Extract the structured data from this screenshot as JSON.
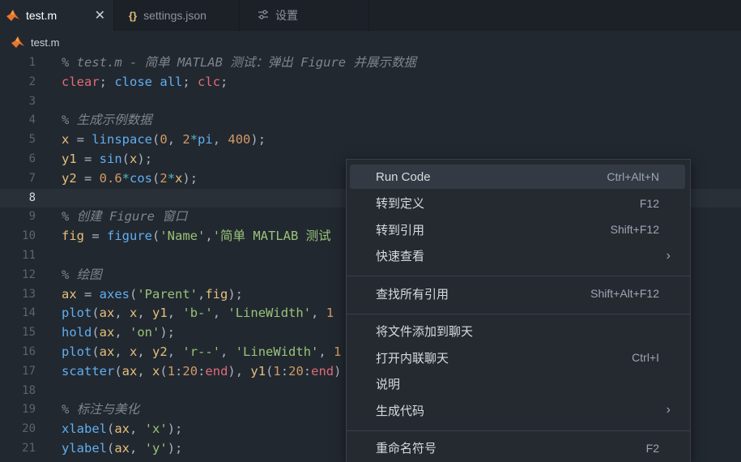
{
  "tabs": [
    {
      "label": "test.m",
      "icon": "matlab-icon",
      "close": "✕"
    },
    {
      "label": "settings.json",
      "icon": "json-braces-icon",
      "glyph": "{}"
    },
    {
      "label": "设置",
      "icon": "settings-sliders-icon",
      "glyph": "⚟"
    }
  ],
  "breadcrumb": {
    "file": "test.m"
  },
  "editor": {
    "current_line": 8,
    "lines": [
      {
        "n": "1",
        "tokens": [
          [
            "cm",
            "% test.m - 简单 MATLAB 测试：弹出 Figure 并展示数据"
          ]
        ]
      },
      {
        "n": "2",
        "tokens": [
          [
            "kw",
            "clear"
          ],
          [
            "pl",
            "; "
          ],
          [
            "fn",
            "close"
          ],
          [
            "pl",
            " "
          ],
          [
            "fn",
            "all"
          ],
          [
            "pl",
            "; "
          ],
          [
            "kw",
            "clc"
          ],
          [
            "pl",
            ";"
          ]
        ]
      },
      {
        "n": "3",
        "tokens": []
      },
      {
        "n": "4",
        "tokens": [
          [
            "cm",
            "% 生成示例数据"
          ]
        ]
      },
      {
        "n": "5",
        "tokens": [
          [
            "id",
            "x"
          ],
          [
            "pl",
            " = "
          ],
          [
            "fn",
            "linspace"
          ],
          [
            "pl",
            "("
          ],
          [
            "num",
            "0"
          ],
          [
            "pl",
            ", "
          ],
          [
            "num",
            "2"
          ],
          [
            "op",
            "*"
          ],
          [
            "fn",
            "pi"
          ],
          [
            "pl",
            ", "
          ],
          [
            "num",
            "400"
          ],
          [
            "pl",
            ");"
          ]
        ]
      },
      {
        "n": "6",
        "tokens": [
          [
            "id",
            "y1"
          ],
          [
            "pl",
            " = "
          ],
          [
            "fn",
            "sin"
          ],
          [
            "pl",
            "("
          ],
          [
            "id",
            "x"
          ],
          [
            "pl",
            ");"
          ]
        ]
      },
      {
        "n": "7",
        "tokens": [
          [
            "id",
            "y2"
          ],
          [
            "pl",
            " = "
          ],
          [
            "num",
            "0.6"
          ],
          [
            "op",
            "*"
          ],
          [
            "fn",
            "cos"
          ],
          [
            "pl",
            "("
          ],
          [
            "num",
            "2"
          ],
          [
            "op",
            "*"
          ],
          [
            "id",
            "x"
          ],
          [
            "pl",
            ");"
          ]
        ]
      },
      {
        "n": "8",
        "tokens": []
      },
      {
        "n": "9",
        "tokens": [
          [
            "cm",
            "% 创建 Figure 窗口"
          ]
        ]
      },
      {
        "n": "10",
        "tokens": [
          [
            "id",
            "fig"
          ],
          [
            "pl",
            " = "
          ],
          [
            "fn",
            "figure"
          ],
          [
            "pl",
            "("
          ],
          [
            "str",
            "'Name'"
          ],
          [
            "pl",
            ","
          ],
          [
            "str",
            "'简单 MATLAB 测试"
          ]
        ]
      },
      {
        "n": "11",
        "tokens": []
      },
      {
        "n": "12",
        "tokens": [
          [
            "cm",
            "% 绘图"
          ]
        ]
      },
      {
        "n": "13",
        "tokens": [
          [
            "id",
            "ax"
          ],
          [
            "pl",
            " = "
          ],
          [
            "fn",
            "axes"
          ],
          [
            "pl",
            "("
          ],
          [
            "str",
            "'Parent'"
          ],
          [
            "pl",
            ","
          ],
          [
            "id",
            "fig"
          ],
          [
            "pl",
            ");"
          ]
        ]
      },
      {
        "n": "14",
        "tokens": [
          [
            "fn",
            "plot"
          ],
          [
            "pl",
            "("
          ],
          [
            "id",
            "ax"
          ],
          [
            "pl",
            ", "
          ],
          [
            "id",
            "x"
          ],
          [
            "pl",
            ", "
          ],
          [
            "id",
            "y1"
          ],
          [
            "pl",
            ", "
          ],
          [
            "str",
            "'b-'"
          ],
          [
            "pl",
            ", "
          ],
          [
            "str",
            "'LineWidth'"
          ],
          [
            "pl",
            ", "
          ],
          [
            "num",
            "1"
          ]
        ]
      },
      {
        "n": "15",
        "tokens": [
          [
            "fn",
            "hold"
          ],
          [
            "pl",
            "("
          ],
          [
            "id",
            "ax"
          ],
          [
            "pl",
            ", "
          ],
          [
            "str",
            "'on'"
          ],
          [
            "pl",
            ");"
          ]
        ]
      },
      {
        "n": "16",
        "tokens": [
          [
            "fn",
            "plot"
          ],
          [
            "pl",
            "("
          ],
          [
            "id",
            "ax"
          ],
          [
            "pl",
            ", "
          ],
          [
            "id",
            "x"
          ],
          [
            "pl",
            ", "
          ],
          [
            "id",
            "y2"
          ],
          [
            "pl",
            ", "
          ],
          [
            "str",
            "'r--'"
          ],
          [
            "pl",
            ", "
          ],
          [
            "str",
            "'LineWidth'"
          ],
          [
            "pl",
            ", "
          ],
          [
            "num",
            "1"
          ]
        ]
      },
      {
        "n": "17",
        "tokens": [
          [
            "fn",
            "scatter"
          ],
          [
            "pl",
            "("
          ],
          [
            "id",
            "ax"
          ],
          [
            "pl",
            ", "
          ],
          [
            "id",
            "x"
          ],
          [
            "pl",
            "("
          ],
          [
            "num",
            "1"
          ],
          [
            "pl",
            ":"
          ],
          [
            "num",
            "20"
          ],
          [
            "pl",
            ":"
          ],
          [
            "kw",
            "end"
          ],
          [
            "pl",
            "), "
          ],
          [
            "id",
            "y1"
          ],
          [
            "pl",
            "("
          ],
          [
            "num",
            "1"
          ],
          [
            "pl",
            ":"
          ],
          [
            "num",
            "20"
          ],
          [
            "pl",
            ":"
          ],
          [
            "kw",
            "end"
          ],
          [
            "pl",
            ")"
          ]
        ]
      },
      {
        "n": "18",
        "tokens": []
      },
      {
        "n": "19",
        "tokens": [
          [
            "cm",
            "% 标注与美化"
          ]
        ]
      },
      {
        "n": "20",
        "tokens": [
          [
            "fn",
            "xlabel"
          ],
          [
            "pl",
            "("
          ],
          [
            "id",
            "ax"
          ],
          [
            "pl",
            ", "
          ],
          [
            "str",
            "'x'"
          ],
          [
            "pl",
            ");"
          ]
        ]
      },
      {
        "n": "21",
        "tokens": [
          [
            "fn",
            "ylabel"
          ],
          [
            "pl",
            "("
          ],
          [
            "id",
            "ax"
          ],
          [
            "pl",
            ", "
          ],
          [
            "str",
            "'y'"
          ],
          [
            "pl",
            ");"
          ]
        ]
      }
    ]
  },
  "context_menu": {
    "items": [
      {
        "label": "Run Code",
        "shortcut": "Ctrl+Alt+N",
        "highlight": true
      },
      {
        "label": "转到定义",
        "shortcut": "F12"
      },
      {
        "label": "转到引用",
        "shortcut": "Shift+F12"
      },
      {
        "label": "快速查看",
        "submenu": "›"
      },
      {
        "separator": true
      },
      {
        "label": "查找所有引用",
        "shortcut": "Shift+Alt+F12"
      },
      {
        "separator": true
      },
      {
        "label": "将文件添加到聊天",
        "shortcut": ""
      },
      {
        "label": "打开内联聊天",
        "shortcut": "Ctrl+I"
      },
      {
        "label": "说明",
        "shortcut": ""
      },
      {
        "label": "生成代码",
        "submenu": "›"
      },
      {
        "separator": true
      },
      {
        "label": "重命名符号",
        "shortcut": "F2"
      }
    ]
  },
  "colors": {
    "accent_orange": "#e8762b",
    "editor_bg": "#222830",
    "menu_bg": "#252a31"
  }
}
